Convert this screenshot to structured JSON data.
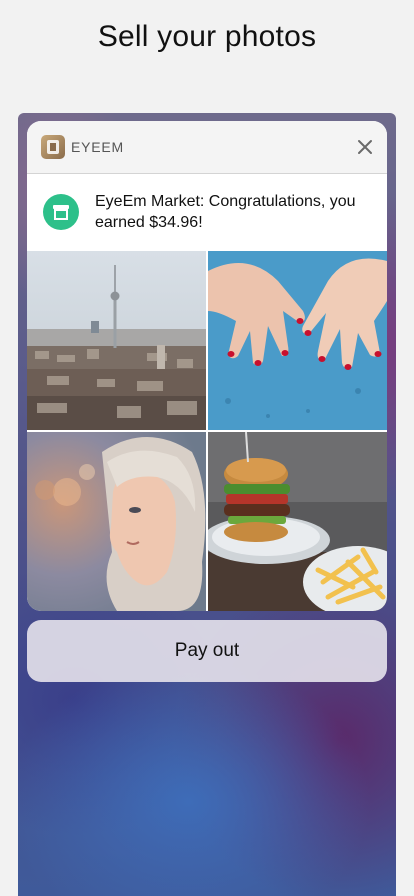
{
  "page": {
    "title": "Sell your photos"
  },
  "notification": {
    "app_name": "EYEEM",
    "message": "EyeEm Market: Congratulations, you earned $34.96!",
    "photos": [
      {
        "subject": "Berlin skyline with TV tower"
      },
      {
        "subject": "Hands with red nail polish on blue surface"
      },
      {
        "subject": "Portrait of blonde woman"
      },
      {
        "subject": "Burger with fries"
      }
    ]
  },
  "action": {
    "payout_label": "Pay out"
  },
  "colors": {
    "market_green": "#2dc08a",
    "background": "#f2f2f2"
  }
}
